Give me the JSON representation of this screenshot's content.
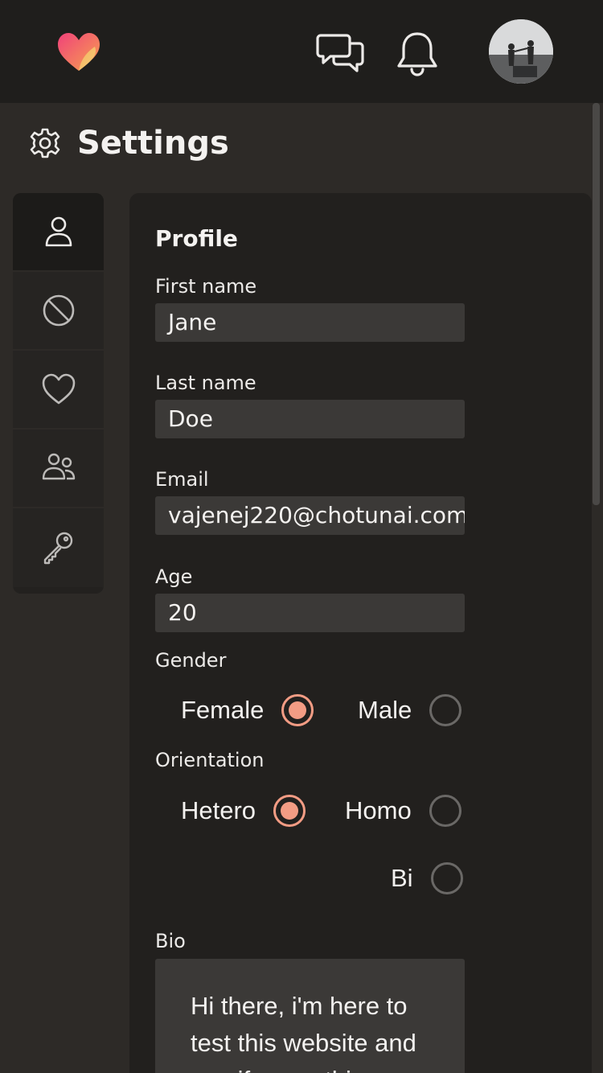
{
  "settings": {
    "title": "Settings"
  },
  "profile": {
    "section_title": "Profile",
    "first_name_label": "First name",
    "first_name_value": "Jane",
    "last_name_label": "Last name",
    "last_name_value": "Doe",
    "email_label": "Email",
    "email_value": "vajenej220@chotunai.com",
    "age_label": "Age",
    "age_value": "20",
    "gender_label": "Gender",
    "gender_options": [
      "Female",
      "Male"
    ],
    "gender_selected": "Female",
    "orientation_label": "Orientation",
    "orientation_options": [
      "Hetero",
      "Homo",
      "Bi"
    ],
    "orientation_selected": "Hetero",
    "bio_label": "Bio",
    "bio_value": "Hi there, i'm here to test this website and see if every thing"
  },
  "icons": {
    "sidebar": [
      "user-icon",
      "block-icon",
      "heart-icon",
      "users-icon",
      "key-icon"
    ],
    "header": [
      "chat-icon",
      "bell-icon",
      "avatar"
    ]
  },
  "colors": {
    "accent": "#f39c84",
    "background": "#2d2a27",
    "topbar": "#1f1e1c",
    "panel": "#22201e",
    "input": "#3b3937"
  }
}
